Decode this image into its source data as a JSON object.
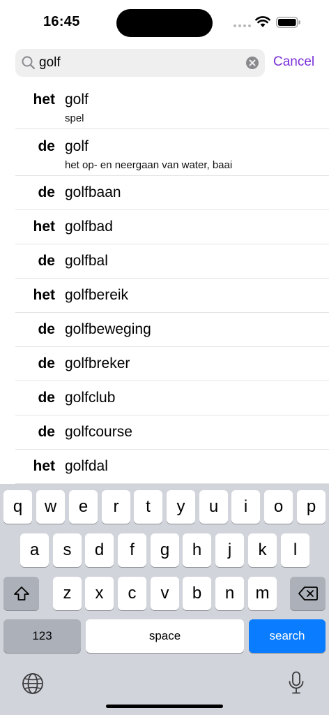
{
  "status": {
    "time": "16:45"
  },
  "search": {
    "query": "golf",
    "cancel_label": "Cancel"
  },
  "results": [
    {
      "article": "het",
      "word": "golf",
      "meaning": "spel"
    },
    {
      "article": "de",
      "word": "golf",
      "meaning": "het op- en neergaan van water, baai"
    },
    {
      "article": "de",
      "word": "golfbaan"
    },
    {
      "article": "het",
      "word": "golfbad"
    },
    {
      "article": "de",
      "word": "golfbal"
    },
    {
      "article": "het",
      "word": "golfbereik"
    },
    {
      "article": "de",
      "word": "golfbeweging"
    },
    {
      "article": "de",
      "word": "golfbreker"
    },
    {
      "article": "de",
      "word": "golfclub"
    },
    {
      "article": "de",
      "word": "golfcourse"
    },
    {
      "article": "het",
      "word": "golfdal"
    }
  ],
  "keyboard": {
    "row1": [
      "q",
      "w",
      "e",
      "r",
      "t",
      "y",
      "u",
      "i",
      "o",
      "p"
    ],
    "row2": [
      "a",
      "s",
      "d",
      "f",
      "g",
      "h",
      "j",
      "k",
      "l"
    ],
    "row3": [
      "z",
      "x",
      "c",
      "v",
      "b",
      "n",
      "m"
    ],
    "numbers_label": "123",
    "space_label": "space",
    "search_label": "search"
  },
  "colors": {
    "accent": "#7a2ed8",
    "keyboard_bg": "#d1d4db",
    "search_key": "#0a7cff"
  },
  "icons": [
    "search-icon",
    "clear-icon",
    "wifi-icon",
    "battery-icon",
    "shift-icon",
    "backspace-icon",
    "globe-icon",
    "mic-icon"
  ]
}
